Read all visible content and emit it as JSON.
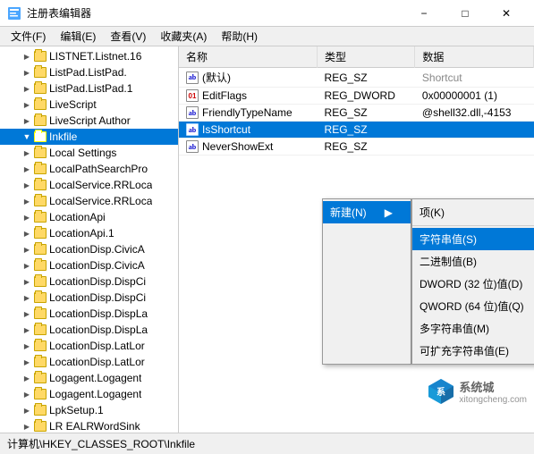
{
  "window": {
    "title": "注册表编辑器",
    "icon": "regedit"
  },
  "menubar": {
    "items": [
      {
        "label": "文件(F)"
      },
      {
        "label": "编辑(E)"
      },
      {
        "label": "查看(V)"
      },
      {
        "label": "收藏夹(A)"
      },
      {
        "label": "帮助(H)"
      }
    ]
  },
  "tree": {
    "items": [
      {
        "label": "LISTNET.Listnet.16",
        "indent": 2,
        "expanded": false
      },
      {
        "label": "ListPad.ListPad.",
        "indent": 2,
        "expanded": false
      },
      {
        "label": "ListPad.ListPad.1",
        "indent": 2,
        "expanded": false
      },
      {
        "label": "LiveScript",
        "indent": 2,
        "expanded": false
      },
      {
        "label": "LiveScript Author",
        "indent": 2,
        "expanded": false
      },
      {
        "label": "Inkfile",
        "indent": 2,
        "expanded": true,
        "selected": true
      },
      {
        "label": "Local Settings",
        "indent": 2,
        "expanded": false
      },
      {
        "label": "LocalPathSearchPro",
        "indent": 2,
        "expanded": false
      },
      {
        "label": "LocalService.RRLoca",
        "indent": 2,
        "expanded": false
      },
      {
        "label": "LocalService.RRLoca",
        "indent": 2,
        "expanded": false
      },
      {
        "label": "LocationApi",
        "indent": 2,
        "expanded": false
      },
      {
        "label": "LocationApi.1",
        "indent": 2,
        "expanded": false
      },
      {
        "label": "LocationDisp.CivicA",
        "indent": 2,
        "expanded": false
      },
      {
        "label": "LocationDisp.CivicA",
        "indent": 2,
        "expanded": false
      },
      {
        "label": "LocationDisp.DispCi",
        "indent": 2,
        "expanded": false
      },
      {
        "label": "LocationDisp.DispCi",
        "indent": 2,
        "expanded": false
      },
      {
        "label": "LocationDisp.DispLa",
        "indent": 2,
        "expanded": false
      },
      {
        "label": "LocationDisp.DispLa",
        "indent": 2,
        "expanded": false
      },
      {
        "label": "LocationDisp.LatLor",
        "indent": 2,
        "expanded": false
      },
      {
        "label": "LocationDisp.LatLor",
        "indent": 2,
        "expanded": false
      },
      {
        "label": "Logagent.Logagent",
        "indent": 2,
        "expanded": false
      },
      {
        "label": "Logagent.Logagent",
        "indent": 2,
        "expanded": false
      },
      {
        "label": "LpkSetup.1",
        "indent": 2,
        "expanded": false
      },
      {
        "label": "LR EALRWordSink",
        "indent": 2,
        "expanded": false
      }
    ]
  },
  "table": {
    "columns": [
      "名称",
      "类型",
      "数据"
    ],
    "rows": [
      {
        "name": "(默认)",
        "type": "REG_SZ",
        "data": "",
        "icon": "ab"
      },
      {
        "name": "EditFlags",
        "type": "REG_DWORD",
        "data": "0x00000001 (1)",
        "icon": "bin"
      },
      {
        "name": "FriendlyTypeName",
        "type": "REG_SZ",
        "data": "@shell32.dll,-4153",
        "icon": "ab"
      },
      {
        "name": "IsShortcut",
        "type": "REG_SZ",
        "data": "",
        "icon": "ab",
        "selected": true
      },
      {
        "name": "NeverShowExt",
        "type": "REG_SZ",
        "data": "",
        "icon": "ab"
      }
    ],
    "header_col1": "名称",
    "header_col2": "类型",
    "header_col3": "数据",
    "partial_data": "Shortcut"
  },
  "context_menu": {
    "new_item": {
      "label": "新建(N)",
      "arrow": "▶"
    },
    "submenu": {
      "items": [
        {
          "label": "项(K)",
          "highlighted": false
        },
        {
          "label": "字符串值(S)",
          "highlighted": true
        },
        {
          "label": "二进制值(B)",
          "highlighted": false
        },
        {
          "label": "DWORD (32 位)值(D)",
          "highlighted": false
        },
        {
          "label": "QWORD (64 位)值(Q)",
          "highlighted": false
        },
        {
          "label": "多字符串值(M)",
          "highlighted": false
        },
        {
          "label": "可扩充字符串值(E)",
          "highlighted": false
        }
      ]
    }
  },
  "status_bar": {
    "text": "计算机\\HKEY_CLASSES_ROOT\\Inkfile"
  },
  "watermark": {
    "text": "系统城",
    "site": "xitongcheng.com"
  }
}
